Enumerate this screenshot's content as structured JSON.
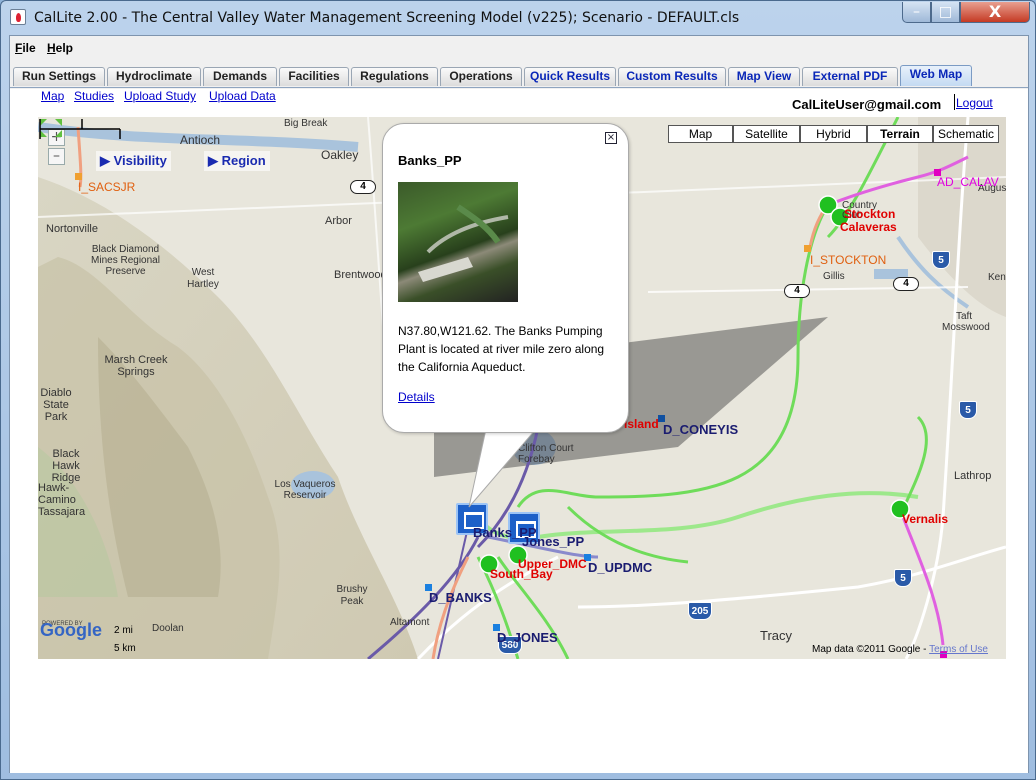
{
  "window": {
    "title": "CalLite 2.00 - The Central Valley Water Management Screening Model (v225); Scenario - DEFAULT.cls",
    "minimize": "–",
    "maximize": "□",
    "close": "X"
  },
  "menus": [
    "File",
    "Help"
  ],
  "tabs": [
    "Run Settings",
    "Hydroclimate",
    "Demands",
    "Facilities",
    "Regulations",
    "Operations",
    "Quick Results",
    "Custom Results",
    "Map View",
    "External PDF",
    "Web Map"
  ],
  "active_tab": "Web Map",
  "links": {
    "map": "Map",
    "studies": "Studies",
    "upload_study": "Upload Study",
    "upload_data": "Upload Data",
    "logout": "Logout"
  },
  "user_email": "CalLiteUser@gmail.com",
  "map": {
    "map_types": [
      "Map",
      "Satellite",
      "Hybrid",
      "Terrain",
      "Schematic"
    ],
    "selected_map_type": "Terrain",
    "controls": {
      "visibility": "Visibility",
      "region": "Region",
      "zoom_in": "+",
      "zoom_out": "–"
    },
    "places": [
      "Antioch",
      "Big Break",
      "Oakley",
      "Arbor",
      "Brentwood",
      "Nortonville",
      "Black Diamond Mines Regional Preserve",
      "West Hartley",
      "Marsh Creek Springs",
      "Diablo State Park",
      "Black Hawk Ridge",
      "Hawk-Camino Tassajara",
      "Los Vaqueros Reservoir",
      "Brushy Peak",
      "Altamont",
      "Tracy",
      "Lathrop",
      "Gillis",
      "Taft Mosswood",
      "Country Club",
      "Augusta",
      "Kent",
      "Clifton Court Forebay",
      "Doolan"
    ],
    "route_shields": {
      "us4_a": "4",
      "us4_b": "4",
      "us4_c": "4",
      "i5_a": "5",
      "i5_b": "5",
      "i5_c": "5",
      "i205": "205",
      "i580": "580"
    },
    "features": {
      "banks_pp": "Banks_PP",
      "jones_pp": "Jones_PP",
      "upper_dmc": "Upper_DMC",
      "south_bay": "South_Bay",
      "d_updmc": "D_UPDMC",
      "d_banks": "D_BANKS",
      "d_jones": "D_JONES",
      "d_coneyis": "D_CONEYIS",
      "island": "Island",
      "vernalis": "Vernalis",
      "stockton": "Stockton",
      "calaveras": "Calaveras",
      "i_stockton": "I_STOCKTON",
      "ad_calav": "AD_CALAV",
      "i_sacsjr": "I_SACSJR"
    },
    "popup": {
      "title": "Banks_PP",
      "description": "N37.80,W121.62. The Banks Pumping Plant is located at river mile zero along the California Aqueduct.",
      "details_link": "Details",
      "close": "×"
    },
    "copyright": "Map data ©2011 Google -",
    "terms": "Terms of Use",
    "google": "Google",
    "powered_by": "POWERED BY",
    "scale_mi": "2 mi",
    "scale_km": "5 km"
  },
  "colors": {
    "tab_blue_text": "#0a27b8",
    "link": "#0000cc",
    "canal_green": "#6fdc5a",
    "canal_magenta": "#e060e0",
    "canal_purple": "#6a5aa8",
    "node_green": "#20c020",
    "label_red": "#e00000"
  }
}
